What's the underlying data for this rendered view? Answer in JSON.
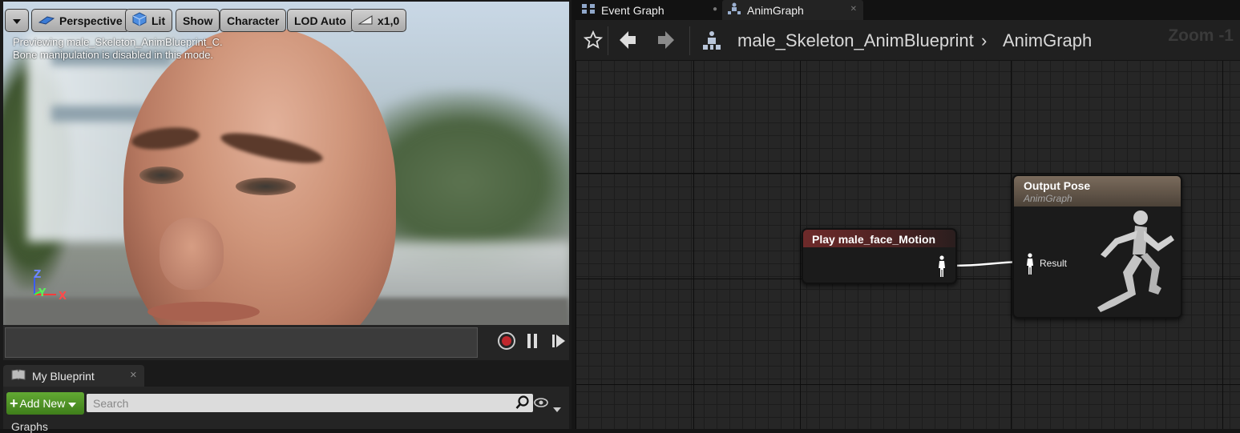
{
  "viewport": {
    "toolbar": {
      "menu_icon": "chevron-down-icon",
      "perspective_label": "Perspective",
      "lit_label": "Lit",
      "show_label": "Show",
      "character_label": "Character",
      "lod_label": "LOD Auto",
      "speed_label": "x1,0"
    },
    "message_line1": "Previewing male_Skeleton_AnimBlueprint_C.",
    "message_line2": "Bone manipulation is disabled in this mode.",
    "axis": {
      "z": "Z",
      "y": "Y",
      "x": "X"
    }
  },
  "timeline": {
    "record_icon": "record-icon",
    "pause_icon": "pause-icon",
    "step_icon": "step-forward-icon"
  },
  "my_blueprint": {
    "tab_label": "My Blueprint",
    "add_new_label": "Add New",
    "search_placeholder": "Search",
    "section_label": "Graphs"
  },
  "document_tabs": [
    {
      "label": "Event Graph",
      "icon": "event-graph-icon",
      "active": false
    },
    {
      "label": "AnimGraph",
      "icon": "anim-graph-icon",
      "active": true
    }
  ],
  "graph": {
    "breadcrumb_root": "male_Skeleton_AnimBlueprint",
    "breadcrumb_separator": "›",
    "breadcrumb_current": "AnimGraph",
    "zoom_label": "Zoom -1",
    "nodes": {
      "play": {
        "title": "Play male_face_Motion"
      },
      "output": {
        "title": "Output Pose",
        "subtitle": "AnimGraph",
        "pin_label": "Result"
      }
    }
  },
  "colors": {
    "add_new_green": "#4e9327",
    "play_node_header": "#6e2a2a",
    "output_node_header": "#7a6b5c",
    "record_red": "#c0282d"
  }
}
